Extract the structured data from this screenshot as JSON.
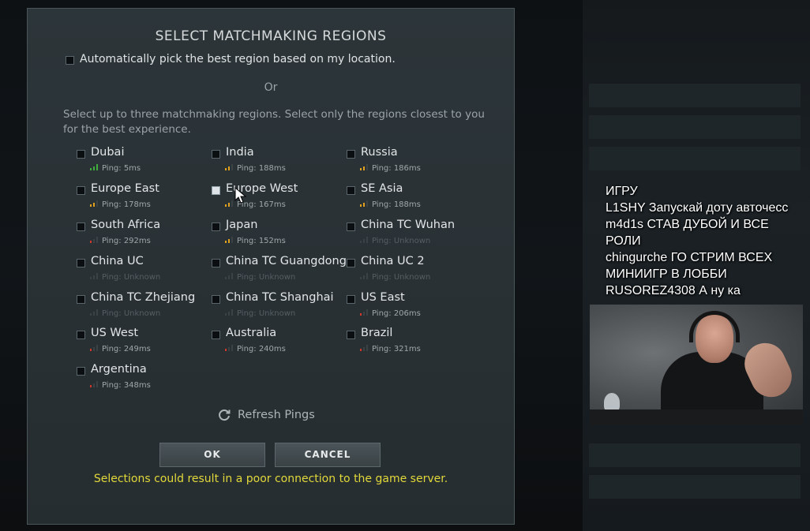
{
  "dialog": {
    "title": "SELECT MATCHMAKING REGIONS",
    "auto_pick_label": "Automatically pick the best region based on my location.",
    "or_label": "Or",
    "instructions": "Select up to three matchmaking regions. Select only the regions closest to you for the best experience.",
    "regions": [
      {
        "name": "Dubai",
        "ping": "Ping: 5ms",
        "signal": "green",
        "hovered": false
      },
      {
        "name": "India",
        "ping": "Ping: 188ms",
        "signal": "yellow",
        "hovered": false
      },
      {
        "name": "Russia",
        "ping": "Ping: 186ms",
        "signal": "yellow",
        "hovered": false
      },
      {
        "name": "Europe East",
        "ping": "Ping: 178ms",
        "signal": "yellow",
        "hovered": false
      },
      {
        "name": "Europe West",
        "ping": "Ping: 167ms",
        "signal": "yellow",
        "hovered": true
      },
      {
        "name": "SE Asia",
        "ping": "Ping: 188ms",
        "signal": "yellow",
        "hovered": false
      },
      {
        "name": "South Africa",
        "ping": "Ping: 292ms",
        "signal": "red",
        "hovered": false
      },
      {
        "name": "Japan",
        "ping": "Ping: 152ms",
        "signal": "yellow",
        "hovered": false
      },
      {
        "name": "China TC Wuhan",
        "ping": "Ping: Unknown",
        "signal": "none",
        "hovered": false
      },
      {
        "name": "China UC",
        "ping": "Ping: Unknown",
        "signal": "none",
        "hovered": false
      },
      {
        "name": "China TC Guangdong",
        "ping": "Ping: Unknown",
        "signal": "none",
        "hovered": false
      },
      {
        "name": "China UC 2",
        "ping": "Ping: Unknown",
        "signal": "none",
        "hovered": false
      },
      {
        "name": "China TC Zhejiang",
        "ping": "Ping: Unknown",
        "signal": "none",
        "hovered": false
      },
      {
        "name": "China TC Shanghai",
        "ping": "Ping: Unknown",
        "signal": "none",
        "hovered": false
      },
      {
        "name": "US East",
        "ping": "Ping: 206ms",
        "signal": "red",
        "hovered": false
      },
      {
        "name": "US West",
        "ping": "Ping: 249ms",
        "signal": "red",
        "hovered": false
      },
      {
        "name": "Australia",
        "ping": "Ping: 240ms",
        "signal": "red",
        "hovered": false
      },
      {
        "name": "Brazil",
        "ping": "Ping: 321ms",
        "signal": "red",
        "hovered": false
      },
      {
        "name": "Argentina",
        "ping": "Ping: 348ms",
        "signal": "red",
        "hovered": false
      }
    ],
    "refresh_label": "Refresh Pings",
    "ok_label": "OK",
    "cancel_label": "CANCEL",
    "warning": "Selections could result in a poor connection to the game server."
  },
  "chat": {
    "lines": [
      {
        "user": "",
        "text": "ИГРУ"
      },
      {
        "user": "L1SHY",
        "text": "Запускай доту авточесс"
      },
      {
        "user": "m4d1s",
        "text": "СТАВ ДУБОЙ И ВСЕ"
      },
      {
        "user": "",
        "text": "РОЛИ"
      },
      {
        "user": "chingurche",
        "text": "ГО СТРИМ ВСЕХ"
      },
      {
        "user": "",
        "text": "МИНИИГР В ЛОББИ"
      },
      {
        "user": "RUSOREZ4308",
        "text": "А ну ка"
      }
    ]
  },
  "colors": {
    "signal_green": "#3fae3c",
    "signal_yellow": "#e0a21e",
    "signal_red": "#d1372b",
    "warning_text": "#e1d83a"
  }
}
